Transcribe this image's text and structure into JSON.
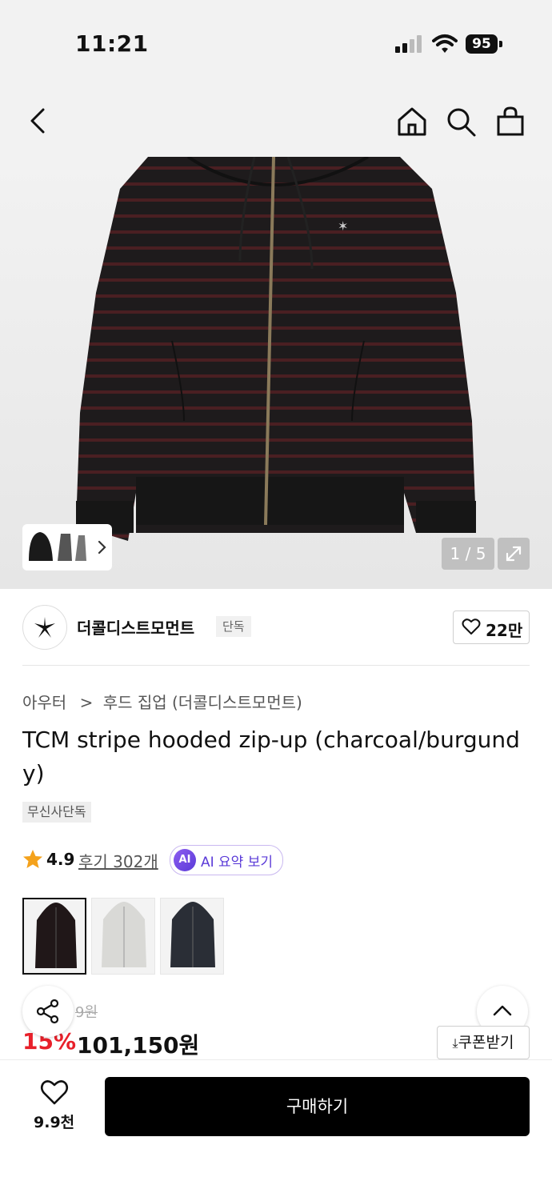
{
  "status_bar": {
    "time": "11:21",
    "battery": "95"
  },
  "header": {
    "back_icon": "chevron-left-icon",
    "home_icon": "home-icon",
    "search_icon": "search-icon",
    "cart_icon": "shopping-bag-icon"
  },
  "gallery": {
    "counter": "1 / 5",
    "expand_icon": "expand-icon",
    "thumb_arrow": "chevron-right-icon"
  },
  "brand": {
    "name": "더콜디스트모먼트",
    "exclusive_tag": "단독",
    "like_count": "22만"
  },
  "breadcrumb": {
    "category": "아우터",
    "separator": ">",
    "subcategory": "후드 집업 (더콜디스트모먼트)"
  },
  "product": {
    "title": "TCM stripe hooded zip-up (charcoal/burgundy)",
    "tag": "무신사단독",
    "rating": "4.9",
    "reviews": "후기 302개",
    "ai_badge": "AI",
    "ai_label": "AI 요약 보기",
    "original_price_partial": "9원",
    "discount": "15%",
    "price": "101,150원"
  },
  "colors": {
    "options": [
      "black",
      "light gray",
      "navy"
    ],
    "selected": 0
  },
  "coupon": {
    "label": "쿠폰받기",
    "icon": "download-icon"
  },
  "bottom": {
    "wish_count": "9.9천",
    "buy_label": "구매하기"
  },
  "theme": {
    "accent_red": "#e8202a",
    "buy_bg": "#000000",
    "ai_purple": "#5b3bd8"
  }
}
